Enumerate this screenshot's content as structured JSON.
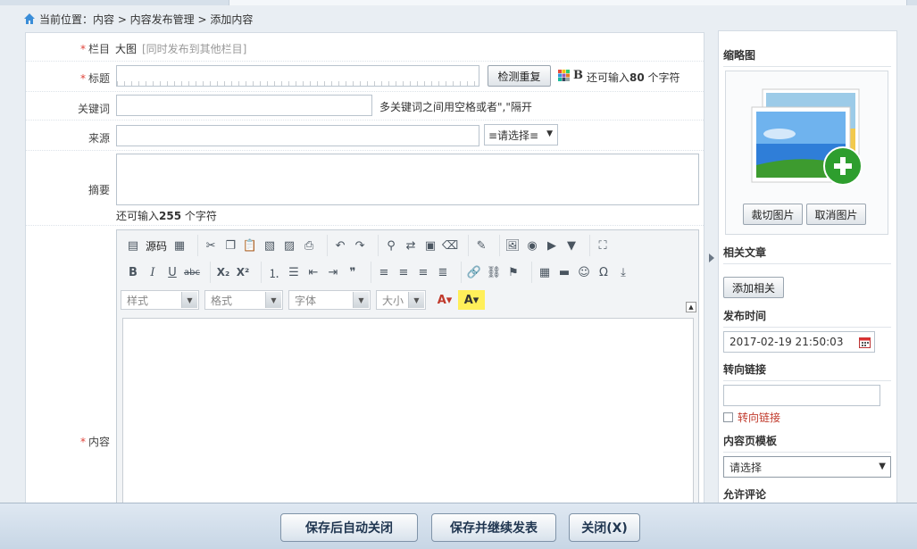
{
  "breadcrumb": {
    "text": "当前位置：内容 > 内容发布管理 > 添加内容"
  },
  "form": {
    "required_mark": "*",
    "category": {
      "label": "栏目",
      "value": "大图",
      "link": "[同时发布到其他栏目]"
    },
    "title": {
      "label": "标题",
      "check_button": "检测重复",
      "bold_icon": "B",
      "counter_prefix": "还可输入",
      "counter_value": "80",
      "counter_suffix": "个字符"
    },
    "keywords": {
      "label": "关键词",
      "hint": "多关键词之间用空格或者\",\"隔开"
    },
    "source": {
      "label": "来源",
      "select_value": "≡请选择≡"
    },
    "summary": {
      "label": "摘要",
      "counter_prefix": "还可输入",
      "counter_value": "255",
      "counter_suffix": "个字符"
    },
    "content": {
      "label": "内容"
    }
  },
  "editor": {
    "source_label": "源码",
    "combos": {
      "style": "样式",
      "format": "格式",
      "font": "字体",
      "size": "大小"
    },
    "bold": "B",
    "italic": "I",
    "underline": "U",
    "strike": "abc",
    "subscript": "X₂",
    "superscript": "X²",
    "quote": "❞",
    "omega": "Ω"
  },
  "sidebar": {
    "thumbnail": {
      "title": "缩略图",
      "crop_button": "裁切图片",
      "cancel_button": "取消图片"
    },
    "related": {
      "title": "相关文章",
      "add_button": "添加相关"
    },
    "publish_time": {
      "title": "发布时间",
      "value": "2017-02-19 21:50:03"
    },
    "redirect": {
      "title": "转向链接",
      "checkbox_label": "转向链接"
    },
    "template": {
      "title": "内容页模板",
      "select_value": "请选择"
    },
    "comments": {
      "title": "允许评论"
    }
  },
  "bottom": {
    "save_close": "保存后自动关闭",
    "save_continue": "保存并继续发表",
    "close": "关闭(X)"
  },
  "colors": {
    "required": "#e0443a",
    "redirect_label": "#c0392b",
    "button_text": "#1f3550"
  }
}
